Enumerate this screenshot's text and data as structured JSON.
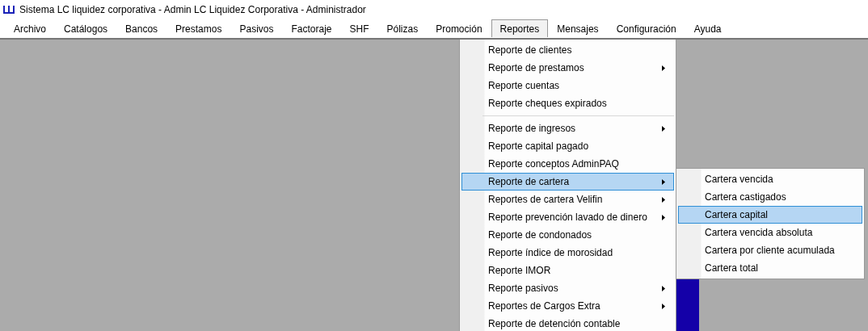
{
  "window": {
    "title": "Sistema LC liquidez corporativa - Admin LC Liquidez Corporativa - Administrador"
  },
  "menubar": [
    {
      "label": "Archivo",
      "selected": false
    },
    {
      "label": "Catálogos",
      "selected": false
    },
    {
      "label": "Bancos",
      "selected": false
    },
    {
      "label": "Prestamos",
      "selected": false
    },
    {
      "label": "Pasivos",
      "selected": false
    },
    {
      "label": "Factoraje",
      "selected": false
    },
    {
      "label": "SHF",
      "selected": false
    },
    {
      "label": "Pólizas",
      "selected": false
    },
    {
      "label": "Promoción",
      "selected": false
    },
    {
      "label": "Reportes",
      "selected": true
    },
    {
      "label": "Mensajes",
      "selected": false
    },
    {
      "label": "Configuración",
      "selected": false
    },
    {
      "label": "Ayuda",
      "selected": false
    }
  ],
  "menu": {
    "items": [
      {
        "kind": "item",
        "label": "Reporte de clientes",
        "submenu": false,
        "selected": false
      },
      {
        "kind": "item",
        "label": "Reporte de prestamos",
        "submenu": true,
        "selected": false
      },
      {
        "kind": "item",
        "label": "Reporte cuentas",
        "submenu": false,
        "selected": false
      },
      {
        "kind": "item",
        "label": "Reporte cheques expirados",
        "submenu": false,
        "selected": false
      },
      {
        "kind": "separator"
      },
      {
        "kind": "item",
        "label": "Reporte de ingresos",
        "submenu": true,
        "selected": false
      },
      {
        "kind": "item",
        "label": "Reporte capital pagado",
        "submenu": false,
        "selected": false
      },
      {
        "kind": "item",
        "label": "Reporte conceptos AdminPAQ",
        "submenu": false,
        "selected": false
      },
      {
        "kind": "item",
        "label": "Reporte de cartera",
        "submenu": true,
        "selected": true
      },
      {
        "kind": "item",
        "label": "Reportes de cartera Velifin",
        "submenu": true,
        "selected": false
      },
      {
        "kind": "item",
        "label": "Reporte prevención lavado de dinero",
        "submenu": true,
        "selected": false
      },
      {
        "kind": "item",
        "label": "Reporte de condonados",
        "submenu": false,
        "selected": false
      },
      {
        "kind": "item",
        "label": "Reporte índice de morosidad",
        "submenu": false,
        "selected": false
      },
      {
        "kind": "item",
        "label": "Reporte IMOR",
        "submenu": false,
        "selected": false
      },
      {
        "kind": "item",
        "label": "Reporte pasivos",
        "submenu": true,
        "selected": false
      },
      {
        "kind": "item",
        "label": "Reportes de Cargos Extra",
        "submenu": true,
        "selected": false
      },
      {
        "kind": "item",
        "label": "Reporte de detención contable",
        "submenu": false,
        "selected": false
      }
    ]
  },
  "submenu": {
    "items": [
      {
        "label": "Cartera vencida",
        "selected": false
      },
      {
        "label": "Cartera castigados",
        "selected": false
      },
      {
        "label": "Cartera capital",
        "selected": true
      },
      {
        "label": "Cartera vencida absoluta",
        "selected": false
      },
      {
        "label": "Cartera por cliente acumulada",
        "selected": false
      },
      {
        "label": "Cartera total",
        "selected": false
      }
    ]
  }
}
